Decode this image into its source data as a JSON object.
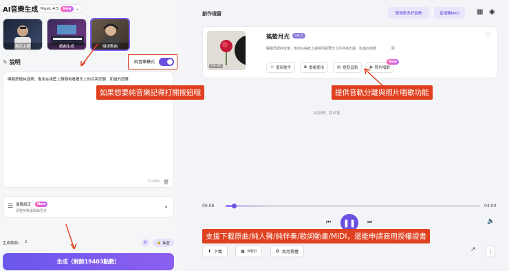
{
  "left": {
    "app_title": "AI音樂生成",
    "model_selector": "Music-4.5",
    "new_badge": "New",
    "styles": [
      {
        "label": "饒舌主義"
      },
      {
        "label": "編曲生成"
      },
      {
        "label": "描述歌曲"
      }
    ],
    "pure_music_label": "純音樂模式",
    "description_title": "說明",
    "description_text": "睡眠舒緩純音樂，像坐在搖籃上靜靜地看著天上的月亮安靜、和諧的感覺",
    "char_count": "32/160",
    "advanced_title": "進階設定",
    "advanced_sub": "調整參數讓歌曲更佳",
    "gen_count_label": "生成歌曲:",
    "gen_count_value": "2",
    "private_label": "私密",
    "generate_button": "生成（剩餘19403點數）"
  },
  "right": {
    "section_title": "創作視窗",
    "discover_button": "發現更多好音樂",
    "midi_button": "音檔轉MIDI",
    "song_title": "搖籃月光",
    "song_version": "v4.5",
    "song_desc": "睡眠舒緩純音樂，像坐在搖籃上靜靜地看著天上的月亮安靜、和諧的感覺",
    "cover_duration": "04:00",
    "actions": {
      "use_singer": "使用歌手",
      "reuse": "重複使用",
      "extract_stems": "提取音軌",
      "photo_sing": "照片唱歌",
      "photo_new": "New"
    },
    "pure_music_note": "純音樂，請欣賞",
    "time_current": "00:08",
    "time_total": "04:00",
    "progress": 0.033,
    "download_label": "下載",
    "midi_label": "MIDI",
    "license_label": "商用授權"
  },
  "annotations": {
    "left_tip": "如果想要純音樂記得打開按鈕哦",
    "right_tip": "提供音軌分離與照片唱歌功能",
    "bottom_tip": "支援下載原曲/純人聲/純伴奏/歌詞動畫/MIDI，還能申請商用授權證書"
  },
  "colors": {
    "accent": "#7b5cf0",
    "annotation": "#e0401f",
    "annotation_border": "#d9381c"
  }
}
